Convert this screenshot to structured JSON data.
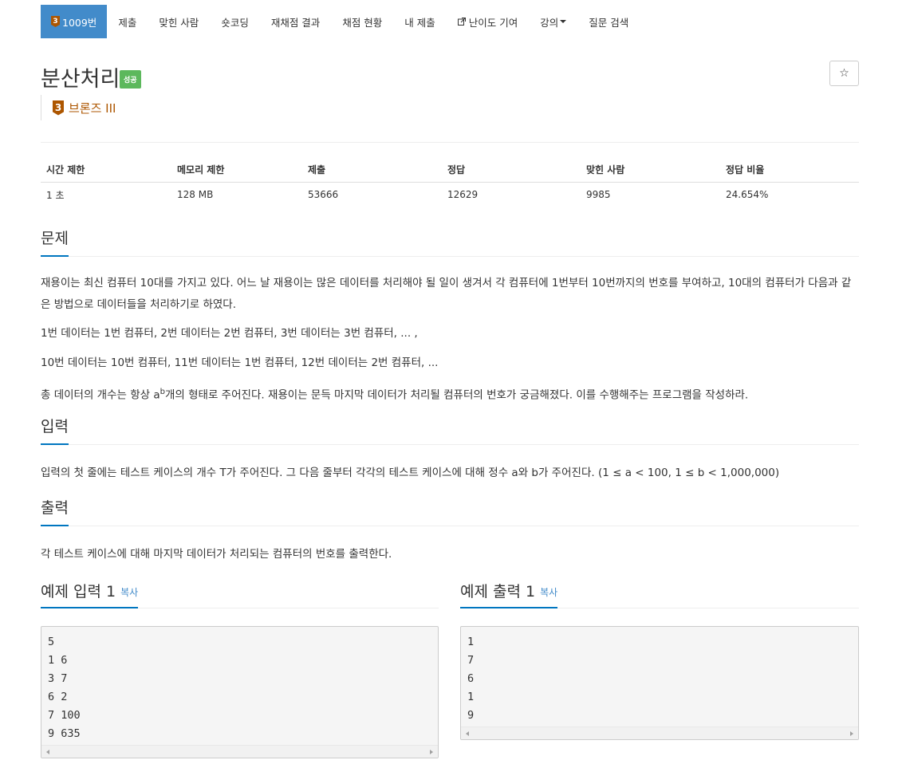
{
  "nav": {
    "problem_tab": "1009번",
    "tier_num": "3",
    "items": [
      "제출",
      "맞힌 사람",
      "숏코딩",
      "재채점 결과",
      "채점 현황",
      "내 제출"
    ],
    "difficulty": "난이도 기여",
    "lecture": "강의",
    "qna": "질문 검색"
  },
  "problem": {
    "title": "분산처리",
    "status_label": "성공",
    "star": "☆",
    "tier_num": "3",
    "tier_name": "브론즈 III"
  },
  "info": {
    "headers": [
      "시간 제한",
      "메모리 제한",
      "제출",
      "정답",
      "맞힌 사람",
      "정답 비율"
    ],
    "values": [
      "1 초",
      "128 MB",
      "53666",
      "12629",
      "9985",
      "24.654%"
    ]
  },
  "sections": {
    "problem": {
      "heading": "문제",
      "p1": "재용이는 최신 컴퓨터 10대를 가지고 있다. 어느 날 재용이는 많은 데이터를 처리해야 될 일이 생겨서 각 컴퓨터에 1번부터 10번까지의 번호를 부여하고, 10대의 컴퓨터가 다음과 같은 방법으로 데이터들을 처리하기로 하였다.",
      "p2": "1번 데이터는 1번 컴퓨터, 2번 데이터는 2번 컴퓨터, 3번 데이터는 3번 컴퓨터, ... ,",
      "p3": "10번 데이터는 10번 컴퓨터, 11번 데이터는 1번 컴퓨터, 12번 데이터는 2번 컴퓨터, ...",
      "p4_a": "총 데이터의 개수는 항상 a",
      "p4_sup": "b",
      "p4_b": "개의 형태로 주어진다. 재용이는 문득 마지막 데이터가 처리될 컴퓨터의 번호가 궁금해졌다. 이를 수행해주는 프로그램을 작성하라."
    },
    "input": {
      "heading": "입력",
      "text": "입력의 첫 줄에는 테스트 케이스의 개수 T가 주어진다. 그 다음 줄부터 각각의 테스트 케이스에 대해 정수 a와 b가 주어진다. (1 ≤ a < 100, 1 ≤ b < 1,000,000)"
    },
    "output": {
      "heading": "출력",
      "text": "각 테스트 케이스에 대해 마지막 데이터가 처리되는 컴퓨터의 번호를 출력한다."
    }
  },
  "samples": {
    "input": {
      "heading": "예제 입력 1",
      "copy": "복사",
      "lines": [
        "5",
        "1 6",
        "3 7",
        "6 2",
        "7 100",
        "9 635"
      ]
    },
    "output": {
      "heading": "예제 출력 1",
      "copy": "복사",
      "lines": [
        "1",
        "7",
        "6",
        "1",
        "9"
      ]
    }
  }
}
